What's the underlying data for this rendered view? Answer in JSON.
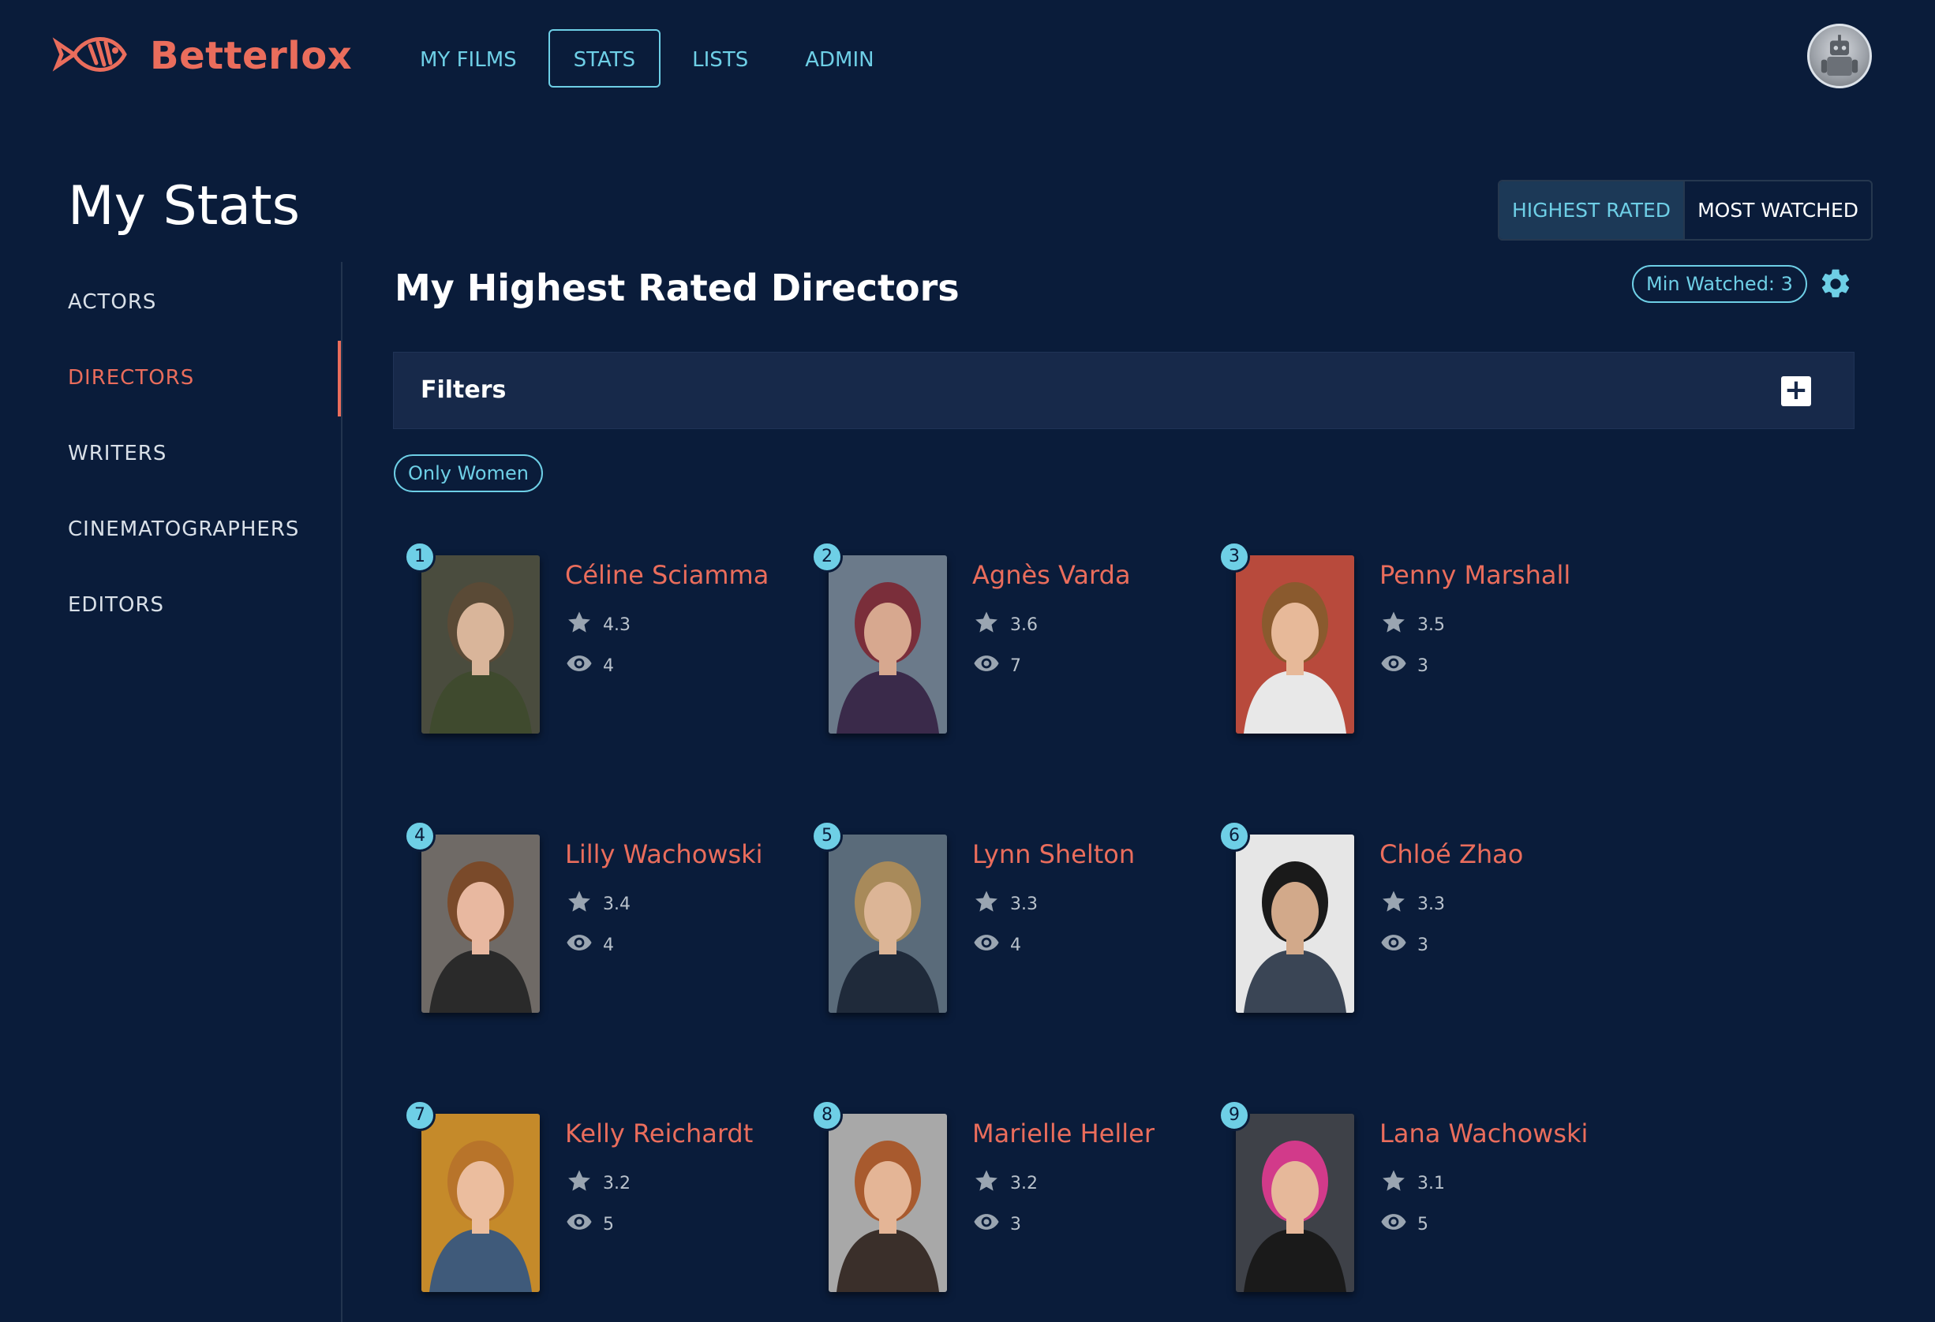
{
  "app": {
    "name": "Betterlox"
  },
  "nav": {
    "items": [
      "MY FILMS",
      "STATS",
      "LISTS",
      "ADMIN"
    ],
    "active": "STATS"
  },
  "page": {
    "title": "My Stats"
  },
  "sidebar": {
    "items": [
      "ACTORS",
      "DIRECTORS",
      "WRITERS",
      "CINEMATOGRAPHERS",
      "EDITORS"
    ],
    "active": "DIRECTORS"
  },
  "toggle": {
    "options": [
      "HIGHEST RATED",
      "MOST WATCHED"
    ],
    "active": "HIGHEST RATED"
  },
  "section": {
    "title": "My Highest Rated Directors",
    "min_watched_label": "Min Watched: 3"
  },
  "filters": {
    "title": "Filters",
    "expand_symbol": "+"
  },
  "chips": {
    "only_women": "Only Women"
  },
  "directors": [
    {
      "rank": "1",
      "name": "Céline Sciamma",
      "rating": "4.3",
      "watched": "4"
    },
    {
      "rank": "2",
      "name": "Agnès Varda",
      "rating": "3.6",
      "watched": "7"
    },
    {
      "rank": "3",
      "name": "Penny Marshall",
      "rating": "3.5",
      "watched": "3"
    },
    {
      "rank": "4",
      "name": "Lilly Wachowski",
      "rating": "3.4",
      "watched": "4"
    },
    {
      "rank": "5",
      "name": "Lynn Shelton",
      "rating": "3.3",
      "watched": "4"
    },
    {
      "rank": "6",
      "name": "Chloé Zhao",
      "rating": "3.3",
      "watched": "3"
    },
    {
      "rank": "7",
      "name": "Kelly Reichardt",
      "rating": "3.2",
      "watched": "5"
    },
    {
      "rank": "8",
      "name": "Marielle Heller",
      "rating": "3.2",
      "watched": "3"
    },
    {
      "rank": "9",
      "name": "Lana Wachowski",
      "rating": "3.1",
      "watched": "5"
    }
  ],
  "colors": {
    "background": "#0a1c3a",
    "accent": "#ea6d5c",
    "link": "#6ecfe6",
    "panel": "#17294a"
  },
  "icons": {
    "logo": "fish-logo-icon",
    "settings": "gear-icon",
    "rating": "star-icon",
    "watched": "eye-icon",
    "expand": "plus-icon",
    "avatar": "robot-avatar"
  }
}
